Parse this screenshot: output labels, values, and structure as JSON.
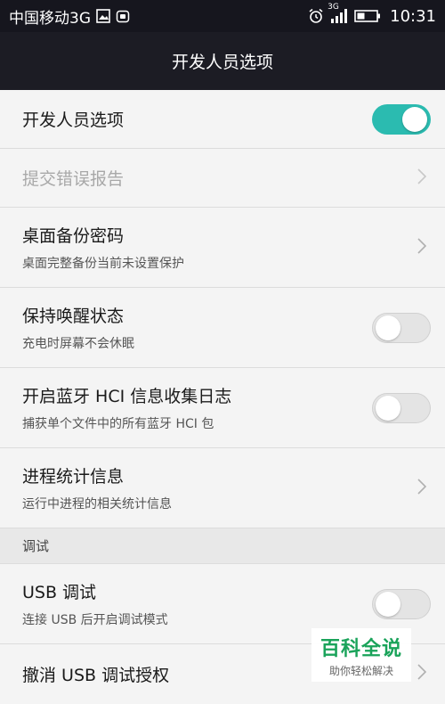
{
  "status_bar": {
    "carrier": "中国移动3G",
    "network": "3G",
    "time": "10:31"
  },
  "app_bar": {
    "title": "开发人员选项"
  },
  "rows": [
    {
      "title": "开发人员选项",
      "subtitle": "",
      "control": "toggle",
      "state": true
    },
    {
      "title": "提交错误报告",
      "subtitle": "",
      "control": "chevron",
      "disabled": true
    },
    {
      "title": "桌面备份密码",
      "subtitle": "桌面完整备份当前未设置保护",
      "control": "chevron"
    },
    {
      "title": "保持唤醒状态",
      "subtitle": "充电时屏幕不会休眠",
      "control": "toggle",
      "state": false
    },
    {
      "title": "开启蓝牙 HCI 信息收集日志",
      "subtitle": "捕获单个文件中的所有蓝牙 HCI 包",
      "control": "toggle",
      "state": false
    },
    {
      "title": "进程统计信息",
      "subtitle": "运行中进程的相关统计信息",
      "control": "chevron"
    }
  ],
  "section_debug": {
    "label": "调试"
  },
  "debug_rows": [
    {
      "title": "USB 调试",
      "subtitle": "连接 USB 后开启调试模式",
      "control": "toggle",
      "state": false
    },
    {
      "title": "撤消 USB 调试授权",
      "subtitle": "",
      "control": "chevron"
    }
  ],
  "watermark": {
    "title": "百科全说",
    "tagline": "助你轻松解决"
  },
  "colors": {
    "accent": "#2bbbb0",
    "appbar": "#1c1c24",
    "statusbar": "#16161e"
  }
}
